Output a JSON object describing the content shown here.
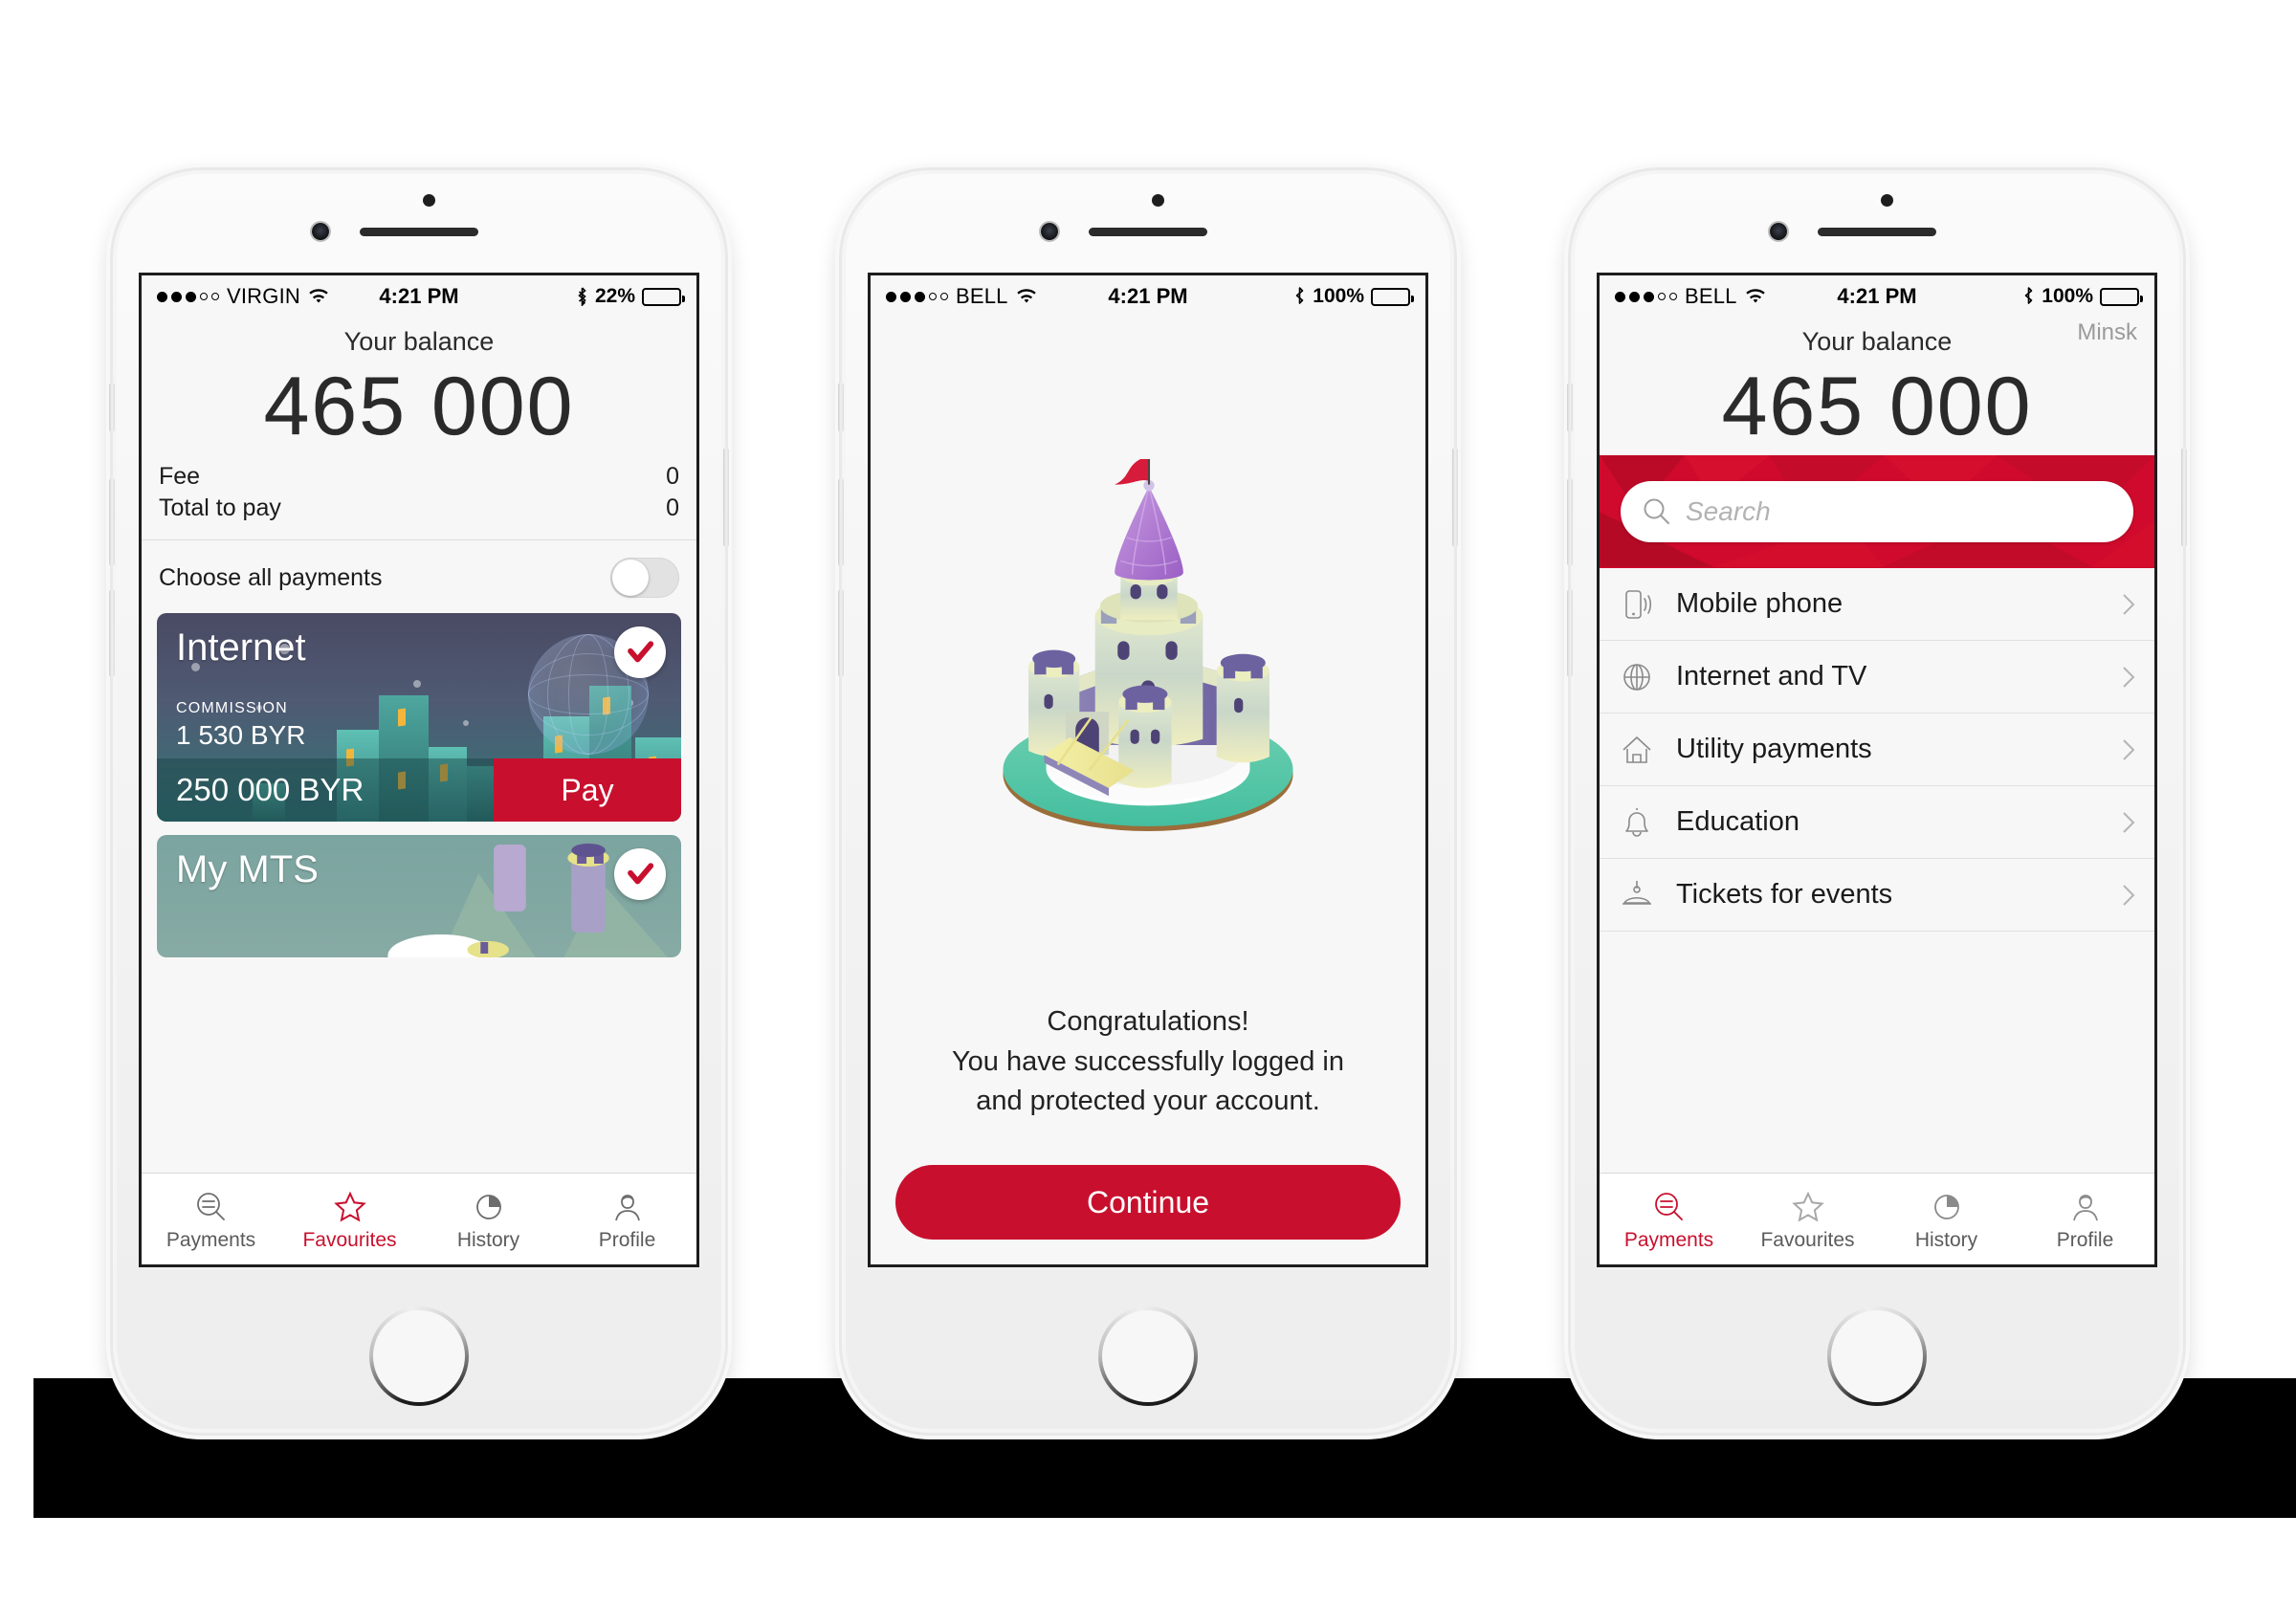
{
  "brand": {
    "accent": "#c8102e",
    "accent_dark": "#a50a24",
    "screen_bg": "#f7f7f7"
  },
  "phones": [
    {
      "id": "phone-favourites",
      "statusbar": {
        "signal_dots_filled": 3,
        "signal_dots_total": 5,
        "carrier": "VIRGIN",
        "time": "4:21 PM",
        "battery_percent": "22%",
        "battery_level": 22
      },
      "screen": {
        "balance_label": "Your balance",
        "balance_value": "465 000",
        "fee_label": "Fee",
        "fee_value": "0",
        "total_label": "Total to pay",
        "total_value": "0",
        "choose_all_label": "Choose all payments",
        "toggle_state": "off",
        "cards": [
          {
            "title": "Internet",
            "commission_label": "COMMISSION",
            "commission_value": "1 530 BYR",
            "amount": "250 000 BYR",
            "pay_label": "Pay",
            "selected": true
          },
          {
            "title": "My MTS",
            "selected": true
          }
        ]
      },
      "tabs": [
        {
          "label": "Payments",
          "icon": "search-icon",
          "active": false
        },
        {
          "label": "Favourites",
          "icon": "star-icon",
          "active": true
        },
        {
          "label": "History",
          "icon": "pie-chart-icon",
          "active": false
        },
        {
          "label": "Profile",
          "icon": "person-icon",
          "active": false
        }
      ]
    },
    {
      "id": "phone-congratulations",
      "statusbar": {
        "signal_dots_filled": 3,
        "signal_dots_total": 5,
        "carrier": "BELL",
        "time": "4:21 PM",
        "battery_percent": "100%",
        "battery_level": 100
      },
      "screen": {
        "illustration": "castle-illustration",
        "message_line1": "Congratulations!",
        "message_line2": "You have successfully logged in",
        "message_line3": "and protected your account.",
        "continue_label": "Continue"
      }
    },
    {
      "id": "phone-payments",
      "statusbar": {
        "signal_dots_filled": 3,
        "signal_dots_total": 5,
        "carrier": "BELL",
        "time": "4:21 PM",
        "battery_percent": "100%",
        "battery_level": 100
      },
      "screen": {
        "city": "Minsk",
        "balance_label": "Your balance",
        "balance_value": "465 000",
        "search_placeholder": "Search",
        "search_value": "",
        "categories": [
          {
            "label": "Mobile phone",
            "icon": "mobile-phone-icon"
          },
          {
            "label": "Internet and TV",
            "icon": "globe-icon"
          },
          {
            "label": "Utility payments",
            "icon": "home-icon"
          },
          {
            "label": "Education",
            "icon": "bell-icon"
          },
          {
            "label": "Tickets for events",
            "icon": "ticket-icon"
          }
        ]
      },
      "tabs": [
        {
          "label": "Payments",
          "icon": "search-icon",
          "active": true
        },
        {
          "label": "Favourites",
          "icon": "star-icon",
          "active": false
        },
        {
          "label": "History",
          "icon": "pie-chart-icon",
          "active": false
        },
        {
          "label": "Profile",
          "icon": "person-icon",
          "active": false
        }
      ]
    }
  ]
}
